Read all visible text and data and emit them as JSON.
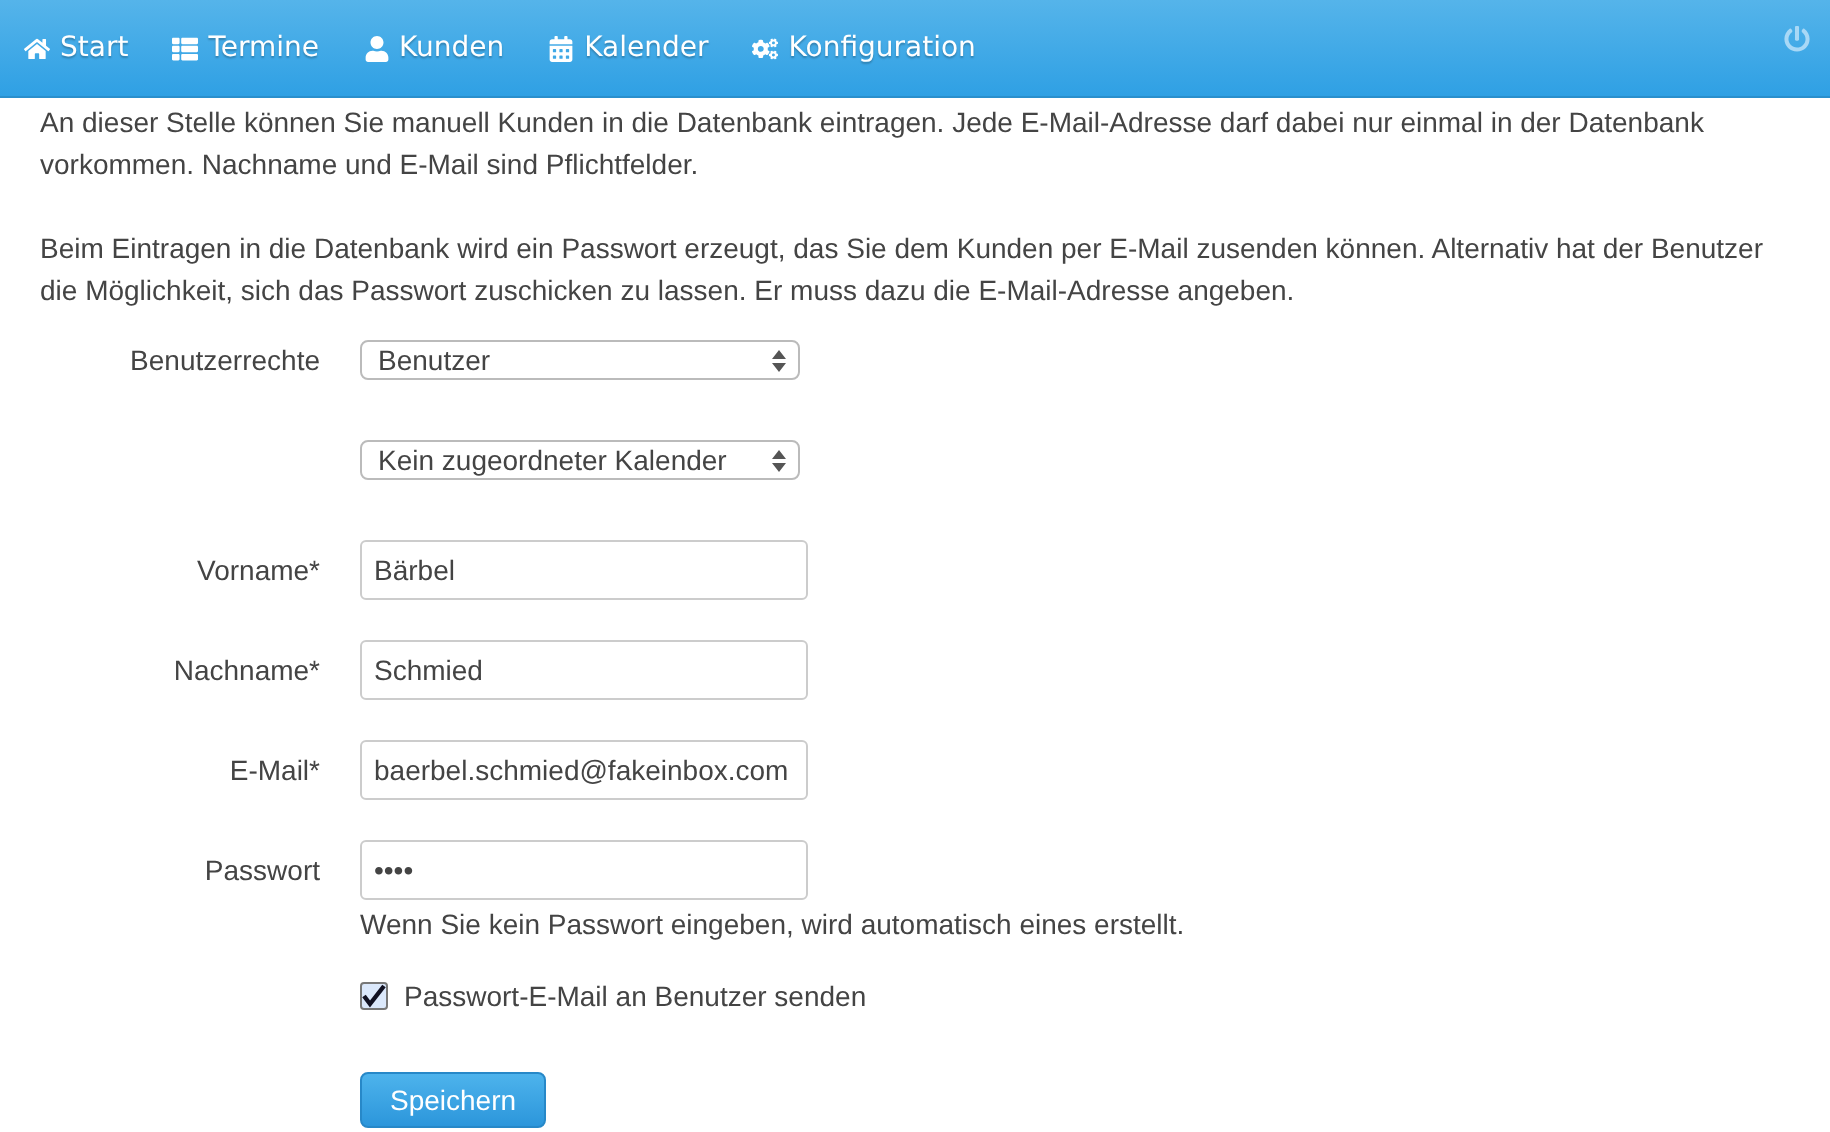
{
  "nav": {
    "items": [
      {
        "label": "Start"
      },
      {
        "label": "Termine"
      },
      {
        "label": "Kunden"
      },
      {
        "label": "Kalender"
      },
      {
        "label": "Konfiguration"
      }
    ]
  },
  "intro": [
    "An dieser Stelle können Sie manuell Kunden in die Datenbank eintragen. Jede E-Mail-Adresse darf dabei nur einmal in der Datenbank vorkommen. Nachname und E-Mail sind Pflichtfelder.",
    "Beim Eintragen in die Datenbank wird ein Passwort erzeugt, das Sie dem Kunden per E-Mail zusenden können. Alternativ hat der Benutzer die Möglichkeit, sich das Passwort zuschicken zu lassen. Er muss dazu die E-Mail-Adresse angeben."
  ],
  "form": {
    "fields": [
      {
        "kind": "select",
        "label": "Benutzerrechte",
        "value": "Benutzer"
      },
      {
        "kind": "select",
        "value": "Kein zugeordneter Kalender"
      },
      {
        "kind": "text",
        "label": "Vorname*",
        "value": "Bärbel"
      },
      {
        "kind": "text",
        "label": "Nachname*",
        "value": "Schmied"
      },
      {
        "kind": "text",
        "label": "E-Mail*",
        "value": "baerbel.schmied@fakeinbox.com"
      },
      {
        "kind": "text",
        "label": "Passwort",
        "value": "••••",
        "help": "Wenn Sie kein Passwort eingeben, wird automatisch eines erstellt."
      }
    ],
    "checkbox": {
      "label": "Passwort-E-Mail an Benutzer senden",
      "checked": true
    },
    "submit": "Speichern"
  }
}
